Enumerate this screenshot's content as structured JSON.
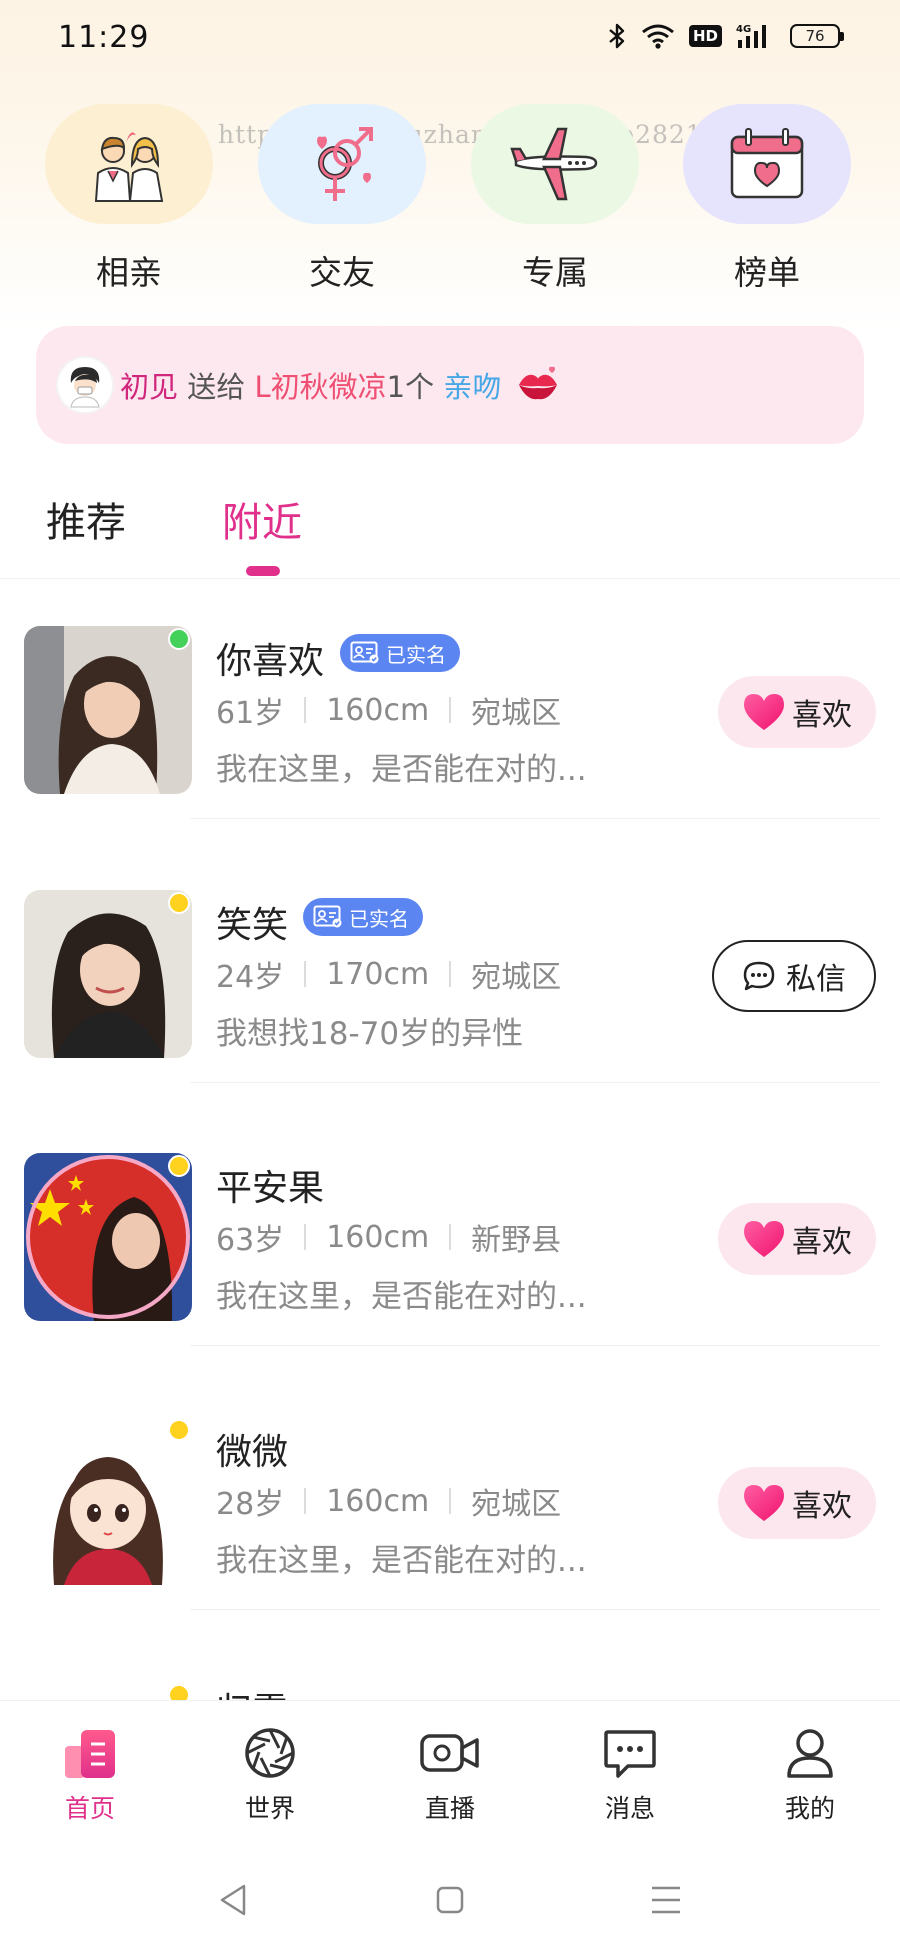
{
  "status_bar": {
    "time": "11:29",
    "battery": "76",
    "hd": "HD",
    "network": "4G"
  },
  "watermark": "https://www.huzhan.com/ishop28218",
  "categories": [
    {
      "label": "相亲",
      "icon": "couple-icon",
      "bg": "#fdf0d2"
    },
    {
      "label": "交友",
      "icon": "gender-symbols-icon",
      "bg": "#e3f0fd"
    },
    {
      "label": "专属",
      "icon": "airplane-icon",
      "bg": "#eaf8e4"
    },
    {
      "label": "榜单",
      "icon": "calendar-heart-icon",
      "bg": "#e6e3fc"
    }
  ],
  "gift_banner": {
    "sender": "初见",
    "verb": "送给",
    "receiver": "L初秋微凉",
    "count": "1个",
    "gift": "亲吻"
  },
  "tabs": [
    {
      "label": "推荐"
    },
    {
      "label": "附近",
      "active": true
    }
  ],
  "users": [
    {
      "name": "你喜欢",
      "verified": true,
      "verified_label": "已实名",
      "age": "61岁",
      "height": "160cm",
      "location": "宛城区",
      "bio": "我在这里，是否能在对的...",
      "action": "like",
      "action_label": "喜欢",
      "online_color": "#43d15a"
    },
    {
      "name": "笑笑",
      "verified": true,
      "verified_label": "已实名",
      "age": "24岁",
      "height": "170cm",
      "location": "宛城区",
      "bio": "我想找18-70岁的异性",
      "action": "message",
      "action_label": "私信",
      "online_color": "#ffd21f"
    },
    {
      "name": "平安果",
      "verified": false,
      "age": "63岁",
      "height": "160cm",
      "location": "新野县",
      "bio": "我在这里，是否能在对的...",
      "action": "like",
      "action_label": "喜欢",
      "online_color": "#ffd21f"
    },
    {
      "name": "微微",
      "verified": false,
      "age": "28岁",
      "height": "160cm",
      "location": "宛城区",
      "bio": "我在这里，是否能在对的...",
      "action": "like",
      "action_label": "喜欢",
      "online_color": "#ffd21f"
    }
  ],
  "partial_user": {
    "name": "归零"
  },
  "bottom_nav": [
    {
      "label": "首页",
      "icon": "home-icon",
      "active": true
    },
    {
      "label": "世界",
      "icon": "aperture-icon"
    },
    {
      "label": "直播",
      "icon": "video-camera-icon"
    },
    {
      "label": "消息",
      "icon": "chat-icon"
    },
    {
      "label": "我的",
      "icon": "profile-icon"
    }
  ],
  "colors": {
    "accent": "#e0308c",
    "like_bg": "#fde7ef",
    "verified": "#5b86f2",
    "banner_bg": "#fde8f0"
  }
}
